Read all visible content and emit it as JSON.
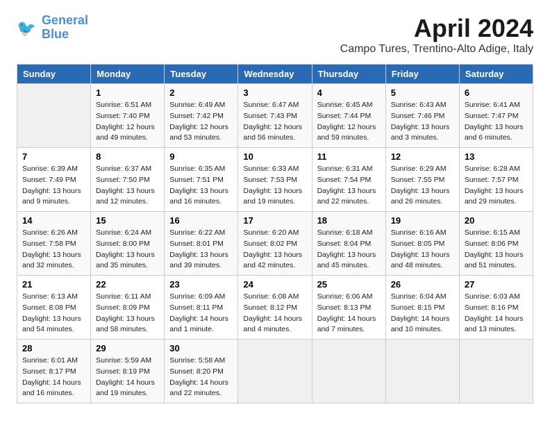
{
  "header": {
    "logo": {
      "line1": "General",
      "line2": "Blue"
    },
    "title": "April 2024",
    "subtitle": "Campo Tures, Trentino-Alto Adige, Italy"
  },
  "days": [
    "Sunday",
    "Monday",
    "Tuesday",
    "Wednesday",
    "Thursday",
    "Friday",
    "Saturday"
  ],
  "weeks": [
    [
      {
        "date": "",
        "content": ""
      },
      {
        "date": "1",
        "content": "Sunrise: 6:51 AM\nSunset: 7:40 PM\nDaylight: 12 hours\nand 49 minutes."
      },
      {
        "date": "2",
        "content": "Sunrise: 6:49 AM\nSunset: 7:42 PM\nDaylight: 12 hours\nand 53 minutes."
      },
      {
        "date": "3",
        "content": "Sunrise: 6:47 AM\nSunset: 7:43 PM\nDaylight: 12 hours\nand 56 minutes."
      },
      {
        "date": "4",
        "content": "Sunrise: 6:45 AM\nSunset: 7:44 PM\nDaylight: 12 hours\nand 59 minutes."
      },
      {
        "date": "5",
        "content": "Sunrise: 6:43 AM\nSunset: 7:46 PM\nDaylight: 13 hours\nand 3 minutes."
      },
      {
        "date": "6",
        "content": "Sunrise: 6:41 AM\nSunset: 7:47 PM\nDaylight: 13 hours\nand 6 minutes."
      }
    ],
    [
      {
        "date": "7",
        "content": "Sunrise: 6:39 AM\nSunset: 7:49 PM\nDaylight: 13 hours\nand 9 minutes."
      },
      {
        "date": "8",
        "content": "Sunrise: 6:37 AM\nSunset: 7:50 PM\nDaylight: 13 hours\nand 12 minutes."
      },
      {
        "date": "9",
        "content": "Sunrise: 6:35 AM\nSunset: 7:51 PM\nDaylight: 13 hours\nand 16 minutes."
      },
      {
        "date": "10",
        "content": "Sunrise: 6:33 AM\nSunset: 7:53 PM\nDaylight: 13 hours\nand 19 minutes."
      },
      {
        "date": "11",
        "content": "Sunrise: 6:31 AM\nSunset: 7:54 PM\nDaylight: 13 hours\nand 22 minutes."
      },
      {
        "date": "12",
        "content": "Sunrise: 6:29 AM\nSunset: 7:55 PM\nDaylight: 13 hours\nand 26 minutes."
      },
      {
        "date": "13",
        "content": "Sunrise: 6:28 AM\nSunset: 7:57 PM\nDaylight: 13 hours\nand 29 minutes."
      }
    ],
    [
      {
        "date": "14",
        "content": "Sunrise: 6:26 AM\nSunset: 7:58 PM\nDaylight: 13 hours\nand 32 minutes."
      },
      {
        "date": "15",
        "content": "Sunrise: 6:24 AM\nSunset: 8:00 PM\nDaylight: 13 hours\nand 35 minutes."
      },
      {
        "date": "16",
        "content": "Sunrise: 6:22 AM\nSunset: 8:01 PM\nDaylight: 13 hours\nand 39 minutes."
      },
      {
        "date": "17",
        "content": "Sunrise: 6:20 AM\nSunset: 8:02 PM\nDaylight: 13 hours\nand 42 minutes."
      },
      {
        "date": "18",
        "content": "Sunrise: 6:18 AM\nSunset: 8:04 PM\nDaylight: 13 hours\nand 45 minutes."
      },
      {
        "date": "19",
        "content": "Sunrise: 6:16 AM\nSunset: 8:05 PM\nDaylight: 13 hours\nand 48 minutes."
      },
      {
        "date": "20",
        "content": "Sunrise: 6:15 AM\nSunset: 8:06 PM\nDaylight: 13 hours\nand 51 minutes."
      }
    ],
    [
      {
        "date": "21",
        "content": "Sunrise: 6:13 AM\nSunset: 8:08 PM\nDaylight: 13 hours\nand 54 minutes."
      },
      {
        "date": "22",
        "content": "Sunrise: 6:11 AM\nSunset: 8:09 PM\nDaylight: 13 hours\nand 58 minutes."
      },
      {
        "date": "23",
        "content": "Sunrise: 6:09 AM\nSunset: 8:11 PM\nDaylight: 14 hours\nand 1 minute."
      },
      {
        "date": "24",
        "content": "Sunrise: 6:08 AM\nSunset: 8:12 PM\nDaylight: 14 hours\nand 4 minutes."
      },
      {
        "date": "25",
        "content": "Sunrise: 6:06 AM\nSunset: 8:13 PM\nDaylight: 14 hours\nand 7 minutes."
      },
      {
        "date": "26",
        "content": "Sunrise: 6:04 AM\nSunset: 8:15 PM\nDaylight: 14 hours\nand 10 minutes."
      },
      {
        "date": "27",
        "content": "Sunrise: 6:03 AM\nSunset: 8:16 PM\nDaylight: 14 hours\nand 13 minutes."
      }
    ],
    [
      {
        "date": "28",
        "content": "Sunrise: 6:01 AM\nSunset: 8:17 PM\nDaylight: 14 hours\nand 16 minutes."
      },
      {
        "date": "29",
        "content": "Sunrise: 5:59 AM\nSunset: 8:19 PM\nDaylight: 14 hours\nand 19 minutes."
      },
      {
        "date": "30",
        "content": "Sunrise: 5:58 AM\nSunset: 8:20 PM\nDaylight: 14 hours\nand 22 minutes."
      },
      {
        "date": "",
        "content": ""
      },
      {
        "date": "",
        "content": ""
      },
      {
        "date": "",
        "content": ""
      },
      {
        "date": "",
        "content": ""
      }
    ]
  ]
}
